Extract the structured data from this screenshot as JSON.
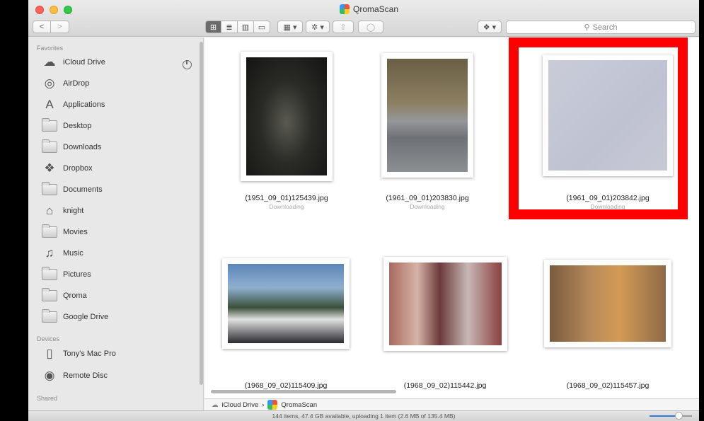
{
  "window": {
    "title": "QromaScan"
  },
  "toolbar": {
    "back": "<",
    "forward": ">",
    "view_icon": "⊞",
    "view_list": "≣",
    "view_columns": "▥",
    "view_gallery": "▭",
    "arrange": "▦ ▾",
    "action": "✲ ▾",
    "share": "⇧",
    "tags": "◯",
    "dropbox": "❖ ▾",
    "search_placeholder": "Search",
    "search_glyph": "⚲"
  },
  "sidebar": {
    "favorites_header": "Favorites",
    "favorites": [
      {
        "label": "iCloud Drive",
        "icon": "☁"
      },
      {
        "label": "AirDrop",
        "icon": "◎"
      },
      {
        "label": "Applications",
        "icon": "A"
      },
      {
        "label": "Desktop",
        "icon": "folder"
      },
      {
        "label": "Downloads",
        "icon": "folder"
      },
      {
        "label": "Dropbox",
        "icon": "❖"
      },
      {
        "label": "Documents",
        "icon": "folder"
      },
      {
        "label": "knight",
        "icon": "⌂"
      },
      {
        "label": "Movies",
        "icon": "folder"
      },
      {
        "label": "Music",
        "icon": "♫"
      },
      {
        "label": "Pictures",
        "icon": "folder"
      },
      {
        "label": "Qroma",
        "icon": "folder"
      },
      {
        "label": "Google Drive",
        "icon": "folder"
      }
    ],
    "devices_header": "Devices",
    "devices": [
      {
        "label": "Tony's Mac Pro",
        "icon": "▯"
      },
      {
        "label": "Remote Disc",
        "icon": "◉"
      }
    ],
    "shared_header": "Shared"
  },
  "files": [
    {
      "name": "(1951_09_01)125439.jpg",
      "status": "Downloading"
    },
    {
      "name": "(1961_09_01)203830.jpg",
      "status": "Downloading"
    },
    {
      "name": "(1961_09_01)203842.jpg",
      "status": "Downloading"
    },
    {
      "name": "(1968_09_02)115409.jpg",
      "status": ""
    },
    {
      "name": "(1968_09_02)115442.jpg",
      "status": ""
    },
    {
      "name": "(1968_09_02)115457.jpg",
      "status": ""
    }
  ],
  "pathbar": {
    "root": "iCloud Drive",
    "sep": "›",
    "current": "QromaScan"
  },
  "status": {
    "text": "144 items, 47.4 GB available, uploading 1 item (2.6 MB of 135.4 MB)"
  }
}
